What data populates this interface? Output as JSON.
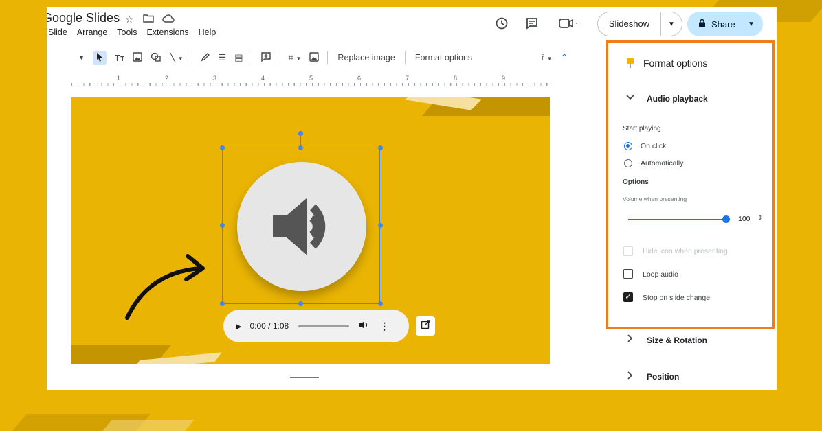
{
  "app": {
    "title": "Google Slides",
    "menu": [
      "Slide",
      "Arrange",
      "Tools",
      "Extensions",
      "Help"
    ]
  },
  "header": {
    "slideshow_label": "Slideshow",
    "share_label": "Share"
  },
  "toolbar": {
    "replace_image": "Replace image",
    "format_options": "Format options"
  },
  "ruler": {
    "numbers": [
      "1",
      "2",
      "3",
      "4",
      "5",
      "6",
      "7",
      "8",
      "9"
    ]
  },
  "player": {
    "time": "0:00 / 1:08"
  },
  "panel": {
    "title": "Format options",
    "audio_playback": "Audio playback",
    "start_playing": "Start playing",
    "on_click": "On click",
    "automatically": "Automatically",
    "start_selected": "On click",
    "options": "Options",
    "volume_label": "Volume when presenting",
    "volume": 100,
    "volume_text": "100",
    "hide_icon": "Hide icon when presenting",
    "hide_icon_checked": false,
    "loop_audio": "Loop audio",
    "loop_checked": false,
    "stop_on_change": "Stop on slide change",
    "stop_checked": true,
    "size_rotation": "Size & Rotation",
    "position": "Position"
  },
  "colors": {
    "background": "#e9b404",
    "highlight": "#f07c1a",
    "accent": "#1a73e8",
    "share_bg": "#c2e7ff"
  },
  "icons": [
    "star-icon",
    "move-folder-icon",
    "cloud-status-icon",
    "history-icon",
    "comment-icon",
    "meet-icon",
    "lock-icon",
    "speaker-icon",
    "play-icon",
    "volume-icon",
    "more-vert-icon",
    "open-in-new-icon",
    "format-options-icon",
    "chevron-down-icon",
    "chevron-right-icon"
  ]
}
